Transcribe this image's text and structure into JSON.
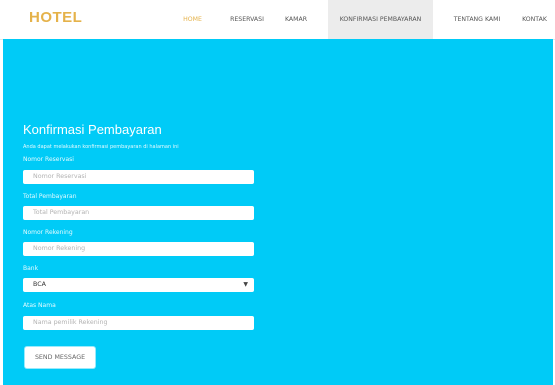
{
  "brand": {
    "name": "HOTEL",
    "color": "#e5b24a"
  },
  "nav": {
    "items": [
      {
        "label": "HOME",
        "state": "active"
      },
      {
        "label": "RESERVASI",
        "state": "normal"
      },
      {
        "label": "KAMAR",
        "state": "normal"
      },
      {
        "label": "KONFIRMASI PEMBAYARAN",
        "state": "selected"
      },
      {
        "label": "TENTANG KAMI",
        "state": "normal"
      },
      {
        "label": "KONTAK",
        "state": "normal"
      }
    ]
  },
  "hero": {
    "background": "#00cbf7"
  },
  "form": {
    "title": "Konfirmasi Pembayaran",
    "subtitle": "Anda dapat melakukan konfirmasi pembayaran di halaman ini",
    "fields": [
      {
        "label": "Nomor Reservasi",
        "placeholder": "Nomor Reservasi",
        "value": ""
      },
      {
        "label": "Total Pembayaran",
        "placeholder": "Total Pembayaran",
        "value": ""
      },
      {
        "label": "Nomor Rekening",
        "placeholder": "Nomor Rekening",
        "value": ""
      }
    ],
    "bank": {
      "label": "Bank",
      "selected": "BCA"
    },
    "atas_nama": {
      "label": "Atas Nama",
      "placeholder": "Nama pemilik Rekening",
      "value": ""
    },
    "submit_label": "SEND MESSAGE"
  }
}
